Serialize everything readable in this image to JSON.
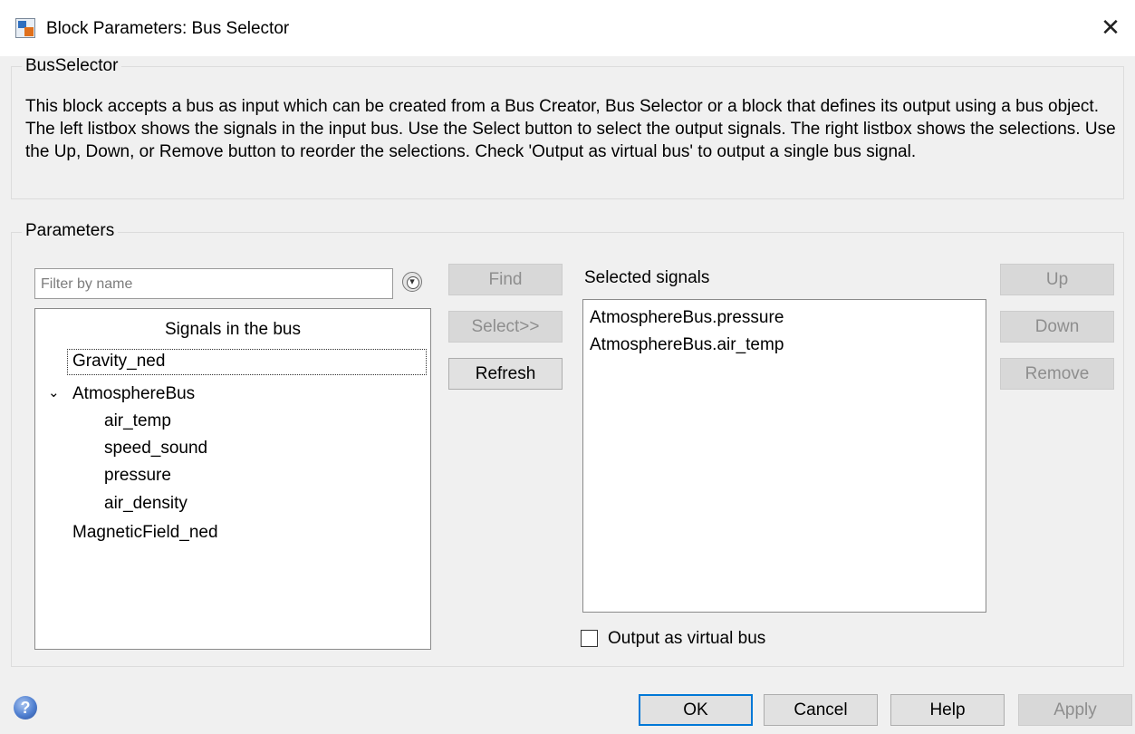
{
  "window": {
    "title": "Block Parameters: Bus Selector",
    "close_glyph": "✕"
  },
  "description_group": {
    "title": "BusSelector",
    "text": "This block accepts a bus as input which can be created from a Bus Creator, Bus Selector or a block that defines its output using a bus object. The left listbox shows the signals in the input bus. Use the Select button to select the output signals. The right listbox shows the selections. Use the Up, Down, or Remove button to reorder the selections. Check 'Output as virtual bus' to output a single bus signal."
  },
  "parameters": {
    "title": "Parameters",
    "filter_placeholder": "Filter by name",
    "filter_options_icon": "filter-options-icon",
    "find_label": "Find",
    "select_label": "Select>>",
    "refresh_label": "Refresh",
    "signals_header": "Signals in the bus",
    "signals": {
      "gravity": "Gravity_ned",
      "atmosphere": "AtmosphereBus",
      "air_temp": "air_temp",
      "speed_sound": "speed_sound",
      "pressure": "pressure",
      "air_density": "air_density",
      "magnetic": "MagneticField_ned"
    },
    "selected_label": "Selected signals",
    "selected": [
      "AtmosphereBus.pressure",
      "AtmosphereBus.air_temp"
    ],
    "up_label": "Up",
    "down_label": "Down",
    "remove_label": "Remove",
    "output_virtual_label": "Output as virtual bus",
    "output_virtual_checked": false
  },
  "footer": {
    "help_icon_glyph": "?",
    "ok_label": "OK",
    "cancel_label": "Cancel",
    "help_label": "Help",
    "apply_label": "Apply"
  },
  "colors": {
    "focus_border": "#0078d7",
    "disabled_text": "#8e8e8e"
  }
}
